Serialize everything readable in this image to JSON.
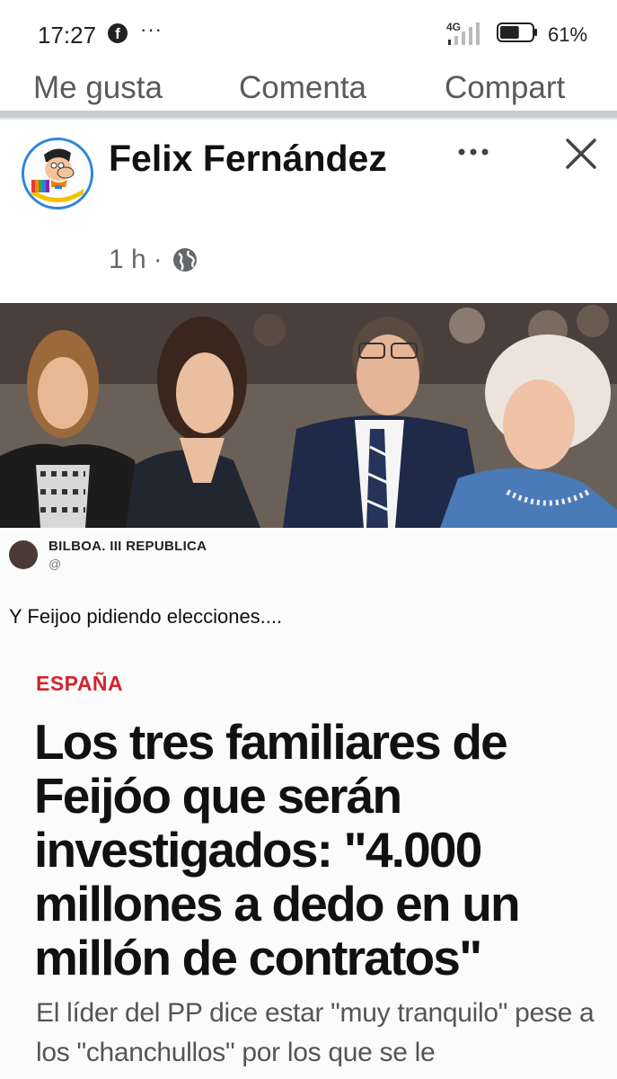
{
  "status_bar": {
    "time": "17:27",
    "notification_icon": "facebook-icon",
    "more_indicator": "···",
    "network": "4G",
    "battery_percent": "61%",
    "battery_level": 0.61
  },
  "actions": {
    "like": "Me gusta",
    "comment": "Comenta",
    "share": "Compart"
  },
  "post": {
    "author": "Felix Fernández",
    "time": "1 h",
    "separator": "·",
    "privacy_icon": "globe-icon",
    "more_icon": "more-horizontal-icon",
    "close_icon": "close-icon"
  },
  "image": {
    "source_name": "BILBOA. III REPUBLICA",
    "source_handle": "@",
    "tweet_text": "Y Feijoo pidiendo elecciones....",
    "section": "ESPAÑA",
    "headline": "Los tres familiares de Feijóo que serán investigados: \"4.000 millones a dedo en un millón de contratos\"",
    "subtitle": "El líder del PP dice estar \"muy tranquilo\" pese a los \"chanchullos\" por los que se le"
  },
  "colors": {
    "accent": "#d1252d",
    "avatar_ring": "#2d86d9",
    "divider": "#c9ccd1",
    "meta_text": "#65676b"
  }
}
